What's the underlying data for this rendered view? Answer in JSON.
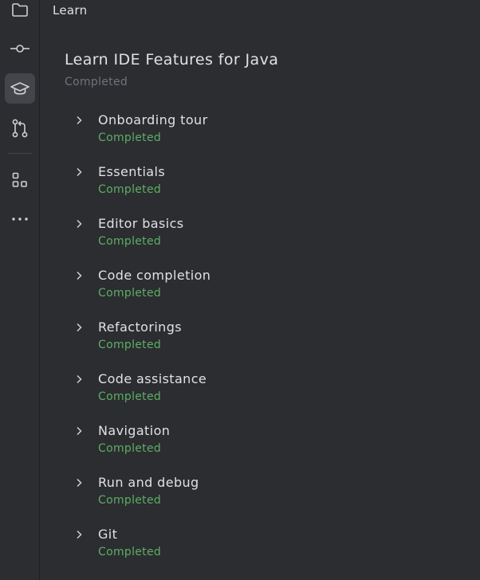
{
  "toolstrip": {
    "items": [
      {
        "icon": "folder-icon",
        "active": false
      },
      {
        "icon": "commit-icon",
        "active": false
      },
      {
        "icon": "learn-icon",
        "active": true
      },
      {
        "icon": "pull-requests-icon",
        "active": false
      },
      {
        "icon": "structure-icon",
        "active": false
      },
      {
        "icon": "more-icon",
        "active": false
      }
    ]
  },
  "panel": {
    "title": "Learn"
  },
  "course": {
    "title": "Learn IDE Features for Java",
    "status": "Completed"
  },
  "lessons": [
    {
      "name": "Onboarding tour",
      "status": "Completed"
    },
    {
      "name": "Essentials",
      "status": "Completed"
    },
    {
      "name": "Editor basics",
      "status": "Completed"
    },
    {
      "name": "Code completion",
      "status": "Completed"
    },
    {
      "name": "Refactorings",
      "status": "Completed"
    },
    {
      "name": "Code assistance",
      "status": "Completed"
    },
    {
      "name": "Navigation",
      "status": "Completed"
    },
    {
      "name": "Run and debug",
      "status": "Completed"
    },
    {
      "name": "Git",
      "status": "Completed"
    }
  ],
  "colors": {
    "background": "#2b2d30",
    "text": "#dfe1e5",
    "muted": "#6f737a",
    "completed": "#5fad65",
    "active_tool": "#43454a"
  }
}
